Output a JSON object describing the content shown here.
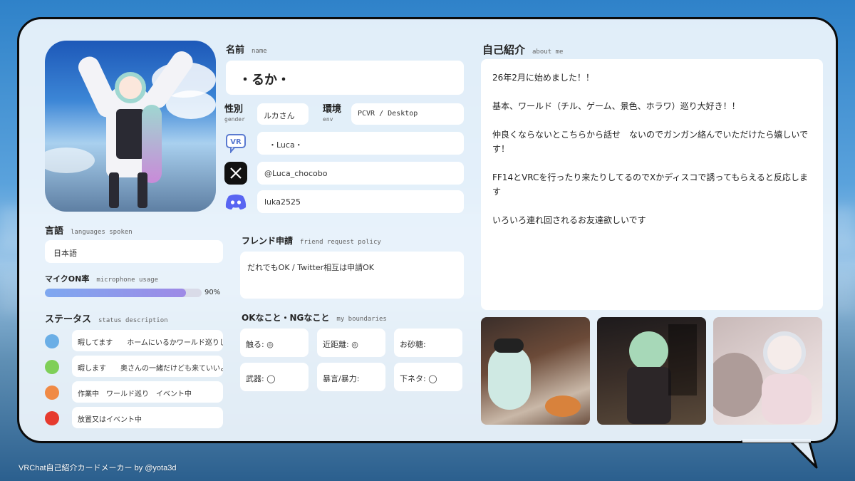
{
  "profile": {
    "name_label": "名前",
    "name_label_en": "name",
    "name": "・るか・",
    "gender_label": "性別",
    "gender_label_en": "gender",
    "gender": "ルカさん",
    "env_label": "環境",
    "env_label_en": "env",
    "env": "PCVR / Desktop",
    "vrchat": "・Luca・",
    "x_handle": "@Luca_chocobo",
    "discord": "luka2525"
  },
  "languages": {
    "label": "言語",
    "label_en": "languages spoken",
    "value": "日本語"
  },
  "mic": {
    "label": "マイクON率",
    "label_en": "microphone usage",
    "percent_text": "90%",
    "fraction": 0.9
  },
  "status": {
    "label": "ステータス",
    "label_en": "status description",
    "items": [
      {
        "color": "#6aaee6",
        "text": "暇してます　　ホームにいるかワールド巡りしてます"
      },
      {
        "color": "#7fcf58",
        "text": "暇します　　奥さんの一緒だけども来ていいよ"
      },
      {
        "color": "#f08a45",
        "text": "作業中　ワールド巡り　イベント中"
      },
      {
        "color": "#e63a2e",
        "text": "放置又はイベント中"
      }
    ]
  },
  "friend_request": {
    "label": "フレンド申請",
    "label_en": "friend request policy",
    "value": "だれでもOK / Twitter相互は申請OK"
  },
  "boundaries": {
    "label": "OKなこと・NGなこと",
    "label_en": "my boundaries",
    "items": [
      {
        "text": "触る: ◎"
      },
      {
        "text": "近距離: ◎"
      },
      {
        "text": "お砂糖:"
      },
      {
        "text": "武器: ◯"
      },
      {
        "text": "暴言/暴力:"
      },
      {
        "text": "下ネタ: ◯"
      }
    ]
  },
  "about": {
    "label": "自己紹介",
    "label_en": "about me",
    "paragraphs": [
      "26年2月に始めました！！",
      "基本、ワールド（チル、ゲーム、景色、ホラワ）巡り大好き！！",
      "仲良くならないとこちらから話せ　ないのでガンガン絡んでいただけたら嬉しいです！",
      "FF14とVRCを行ったり来たりしてるのでXかディスコで誘ってもらえると反応します",
      "いろいろ連れ回されるお友達欲しいです"
    ]
  },
  "icons": {
    "vrchat": "vrchat-logo-icon",
    "x": "x-logo-icon",
    "discord": "discord-logo-icon"
  },
  "colors": {
    "card_bg": "#eef5fc",
    "border": "#0b0b0b",
    "mic_fill_start": "#7ea8f0",
    "mic_fill_end": "#9e8ae6",
    "discord_blue": "#5865f2"
  },
  "footer": {
    "credit": "VRChat自己紹介カードメーカー by @yota3d"
  }
}
